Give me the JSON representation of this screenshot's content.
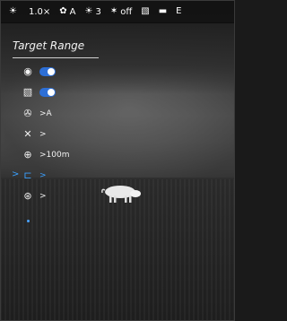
{
  "status_bar": {
    "items": [
      {
        "icon": "sun-icon",
        "glyph": "☀",
        "label": ""
      },
      {
        "icon": "zoom-icon",
        "glyph": "",
        "label": "1.0×"
      },
      {
        "icon": "gear-icon",
        "glyph": "✿",
        "label": "A"
      },
      {
        "icon": "brightness-icon",
        "glyph": "☀",
        "label": "3"
      },
      {
        "icon": "flash-icon",
        "glyph": "✶",
        "label": "off"
      },
      {
        "icon": "picture-icon",
        "glyph": "▧",
        "label": ""
      },
      {
        "icon": "battery-icon",
        "glyph": "▬",
        "label": ""
      },
      {
        "icon": "edge-icon",
        "glyph": "E",
        "label": ""
      }
    ]
  },
  "menu": {
    "title": "Target Range",
    "rows": [
      {
        "name": "eye-toggle",
        "icon": "eye-icon",
        "glyph": "◉",
        "type": "toggle",
        "value": "on",
        "label": ""
      },
      {
        "name": "display-toggle",
        "icon": "display-icon",
        "glyph": "▧",
        "type": "toggle",
        "value": "on",
        "label": ""
      },
      {
        "name": "aperture-setting",
        "icon": "aperture-icon",
        "glyph": "✇",
        "type": "value",
        "label": ">A"
      },
      {
        "name": "no-signal-setting",
        "icon": "no-signal-icon",
        "glyph": "✕",
        "type": "value",
        "label": ">"
      },
      {
        "name": "range-setting",
        "icon": "crosshair-icon",
        "glyph": "⊕",
        "type": "value",
        "label": ">100m"
      },
      {
        "name": "reticle-setting",
        "icon": "reticle-icon",
        "glyph": "⊏",
        "type": "value",
        "label": ">",
        "selected": true
      },
      {
        "name": "target-setting",
        "icon": "target-icon",
        "glyph": "⊛",
        "type": "value",
        "label": ">"
      }
    ],
    "selected_marker": ">"
  },
  "colors": {
    "accent": "#2d6fd6",
    "selected": "#39a0ff"
  }
}
